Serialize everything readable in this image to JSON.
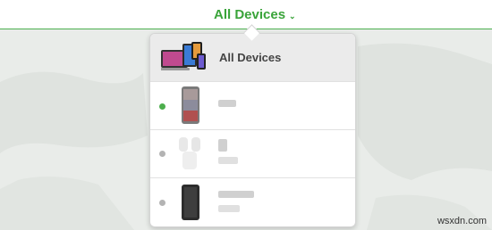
{
  "header": {
    "title": "All Devices",
    "title_color": "#3aa43a"
  },
  "dropdown": {
    "all_devices_label": "All Devices",
    "devices": [
      {
        "status": "online",
        "status_color": "#4cae4c",
        "icon": "phone-icon"
      },
      {
        "status": "offline",
        "status_color": "#b3b3b3",
        "icon": "earbuds-icon"
      },
      {
        "status": "offline",
        "status_color": "#b3b3b3",
        "icon": "phone-icon"
      }
    ]
  },
  "watermark": "wsxdn.com"
}
